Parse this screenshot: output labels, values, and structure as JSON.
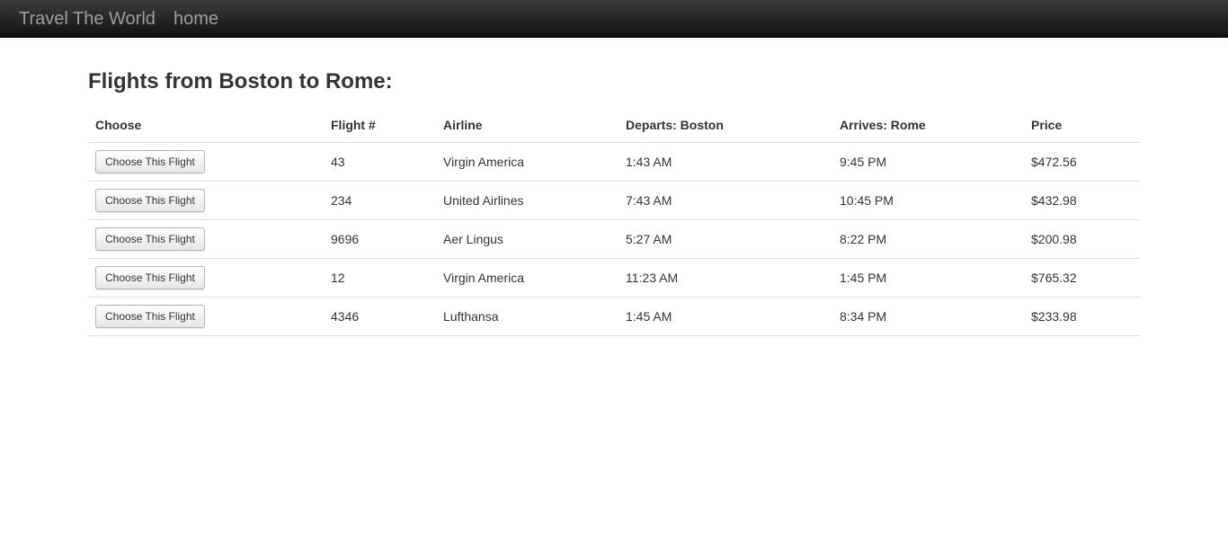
{
  "navbar": {
    "brand": "Travel The World",
    "home_label": "home"
  },
  "page": {
    "title": "Flights from Boston to Rome:"
  },
  "table": {
    "headers": [
      "Choose",
      "Flight #",
      "Airline",
      "Departs: Boston",
      "Arrives: Rome",
      "Price"
    ],
    "button_label": "Choose This Flight",
    "rows": [
      {
        "flight": "43",
        "airline": "Virgin America",
        "departs": "1:43 AM",
        "arrives": "9:45 PM",
        "price": "$472.56"
      },
      {
        "flight": "234",
        "airline": "United Airlines",
        "departs": "7:43 AM",
        "arrives": "10:45 PM",
        "price": "$432.98"
      },
      {
        "flight": "9696",
        "airline": "Aer Lingus",
        "departs": "5:27 AM",
        "arrives": "8:22 PM",
        "price": "$200.98"
      },
      {
        "flight": "12",
        "airline": "Virgin America",
        "departs": "11:23 AM",
        "arrives": "1:45 PM",
        "price": "$765.32"
      },
      {
        "flight": "4346",
        "airline": "Lufthansa",
        "departs": "1:45 AM",
        "arrives": "8:34 PM",
        "price": "$233.98"
      }
    ]
  },
  "colors": {
    "navbar_bg": "#222222",
    "navbar_text": "#9d9d9d",
    "row_border": "#dddddd"
  }
}
